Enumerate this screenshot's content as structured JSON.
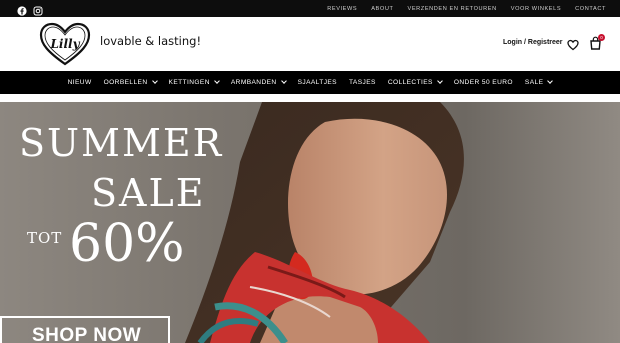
{
  "topbar": {
    "social": [
      "facebook-icon",
      "instagram-icon"
    ],
    "links": [
      "REVIEWS",
      "ABOUT",
      "VERZENDEN EN RETOUREN",
      "VOOR WINKELS",
      "CONTACT"
    ]
  },
  "header": {
    "logo_text": "Lilly",
    "tagline": "lovable & lasting!",
    "login_label": "Login / Registreer",
    "cart_count": "0"
  },
  "nav": {
    "items": [
      {
        "label": "NIEUW",
        "dropdown": false
      },
      {
        "label": "OORBELLEN",
        "dropdown": true
      },
      {
        "label": "KETTINGEN",
        "dropdown": true
      },
      {
        "label": "ARMBANDEN",
        "dropdown": true
      },
      {
        "label": "SJAALTJES",
        "dropdown": false
      },
      {
        "label": "TASJES",
        "dropdown": false
      },
      {
        "label": "COLLECTIES",
        "dropdown": true
      },
      {
        "label": "ONDER 50 EURO",
        "dropdown": false
      },
      {
        "label": "SALE",
        "dropdown": true
      }
    ]
  },
  "hero": {
    "line1": "SUMMER",
    "line2": "SALE",
    "line3_small": "TOT",
    "line3_big": "60%",
    "button": "SHOP NOW"
  },
  "colors": {
    "topbar_bg": "#0d0d0d",
    "nav_bg": "#000000",
    "badge": "#c8102e",
    "scarf_red": "#c8322f"
  }
}
